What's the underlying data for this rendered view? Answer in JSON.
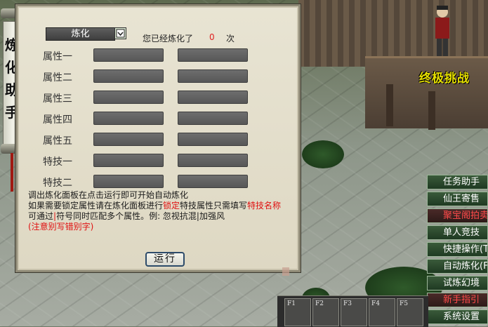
{
  "scroll": {
    "title_chars": [
      "炼",
      "化",
      "助",
      "手"
    ]
  },
  "npc": {
    "name": "终极挑战"
  },
  "panel": {
    "op_select_value": "炼化",
    "count_label": "您已经炼化了",
    "count_value": "0",
    "count_unit": "次",
    "rows": [
      {
        "label": "属性一"
      },
      {
        "label": "属性二"
      },
      {
        "label": "属性三"
      },
      {
        "label": "属性四"
      },
      {
        "label": "属性五"
      },
      {
        "label": "特技一"
      },
      {
        "label": "特技二"
      }
    ],
    "help": {
      "line1": "调出炼化面板在点击运行即可开始自动炼化",
      "line2_a": "如果需要锁定属性请在炼化面板进行",
      "line2_b": "锁定",
      "line2_c": "特技属性只需填写",
      "line2_d": "特技名称",
      "line3_a": "可通过",
      "line3_b": "|",
      "line3_c": "符号同时匹配多个属性。例: 忽视抗混|加强风",
      "line4": "(注意别写错别字)"
    },
    "run_label": "运行"
  },
  "side_menu": [
    {
      "label": "任务助手",
      "red": false
    },
    {
      "label": "仙王寄售",
      "red": false
    },
    {
      "label": "聚宝阁拍卖",
      "red": true
    },
    {
      "label": "单人竞技",
      "red": false
    },
    {
      "label": "快捷操作(Tab)",
      "red": false
    },
    {
      "label": "自动炼化(F1)",
      "red": false
    },
    {
      "label": "试炼幻境",
      "red": false
    },
    {
      "label": "新手指引",
      "red": true
    },
    {
      "label": "系统设置",
      "red": false
    }
  ],
  "hotbar": [
    "F1",
    "F2",
    "F3",
    "F4",
    "F5"
  ]
}
